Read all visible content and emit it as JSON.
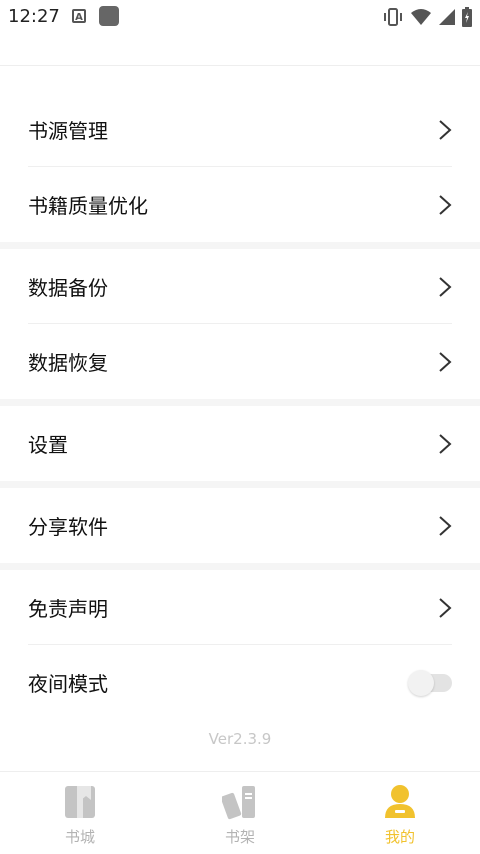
{
  "status": {
    "time": "12:27",
    "a_icon_letter": "A"
  },
  "menu": {
    "items": [
      {
        "label": "书源管理"
      },
      {
        "label": "书籍质量优化"
      },
      {
        "label": "数据备份"
      },
      {
        "label": "数据恢复"
      },
      {
        "label": "设置"
      },
      {
        "label": "分享软件"
      },
      {
        "label": "免责声明"
      },
      {
        "label": "夜间模式"
      }
    ]
  },
  "version": "Ver2.3.9",
  "tabs": [
    {
      "label": "书城"
    },
    {
      "label": "书架"
    },
    {
      "label": "我的"
    }
  ],
  "colors": {
    "accent": "#f1c22e",
    "inactive": "#b3b3b3"
  },
  "night_mode_on": false
}
